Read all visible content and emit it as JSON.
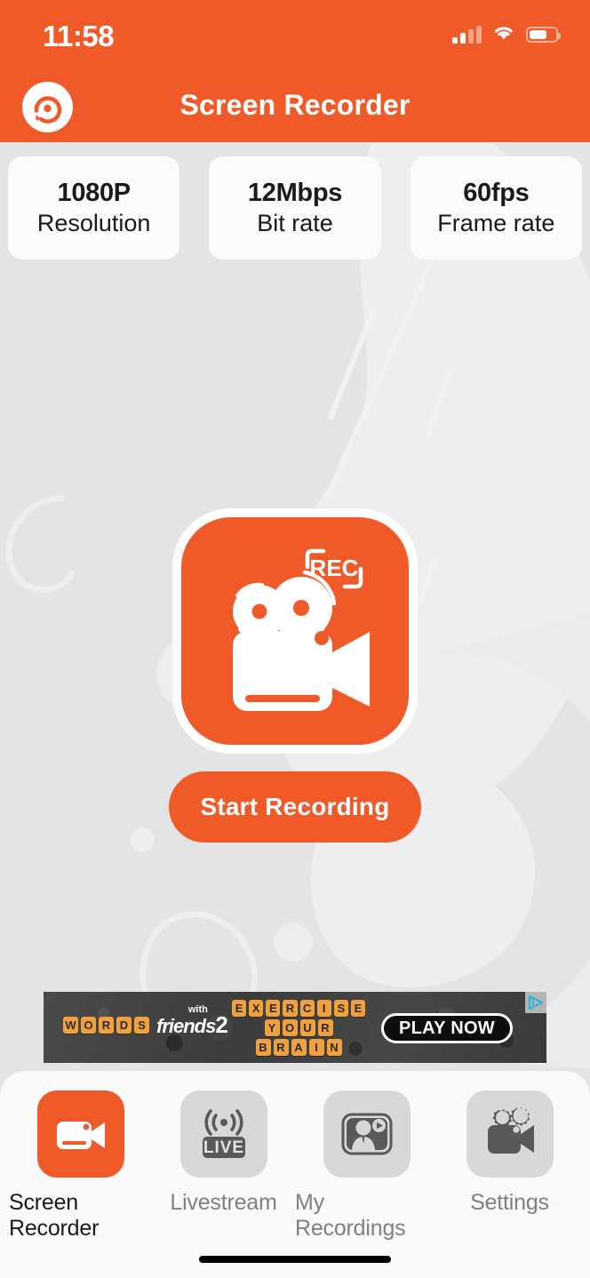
{
  "status_bar": {
    "time": "11:58",
    "signal_icon": "cellular-signal-icon",
    "wifi_icon": "wifi-icon",
    "battery_icon": "battery-icon",
    "battery_level": "60"
  },
  "header": {
    "title": "Screen Recorder",
    "logo_icon": "app-logo-record-icon",
    "background_color": "#ef5a28"
  },
  "stats": [
    {
      "value": "1080P",
      "label": "Resolution",
      "name": "resolution"
    },
    {
      "value": "12Mbps",
      "label": "Bit rate",
      "name": "bit-rate"
    },
    {
      "value": "60fps",
      "label": "Frame rate",
      "name": "frame-rate"
    }
  ],
  "main": {
    "record_tile_icon": "movie-camera-rec-icon",
    "rec_badge_text": "REC",
    "start_button_label": "Start Recording",
    "accent_color": "#ef5a28",
    "background_color": "#e3e4e5"
  },
  "ad": {
    "brand_tiles": [
      "W",
      "O",
      "R",
      "D",
      "S"
    ],
    "brand_with": "with",
    "brand_friends": "friends",
    "brand_number": "2",
    "slogan_rows": [
      [
        "E",
        "X",
        "E",
        "R",
        "C",
        "I",
        "S",
        "E"
      ],
      [
        "Y",
        "O",
        "U",
        "R"
      ],
      [
        "B",
        "R",
        "A",
        "I",
        "N"
      ]
    ],
    "cta_label": "PLAY NOW",
    "adchoices_icon": "adchoices-icon"
  },
  "tabs": [
    {
      "label": "Screen Recorder",
      "icon": "video-camera-icon",
      "active": true
    },
    {
      "label": "Livestream",
      "icon": "live-broadcast-icon",
      "active": false
    },
    {
      "label": "My Recordings",
      "icon": "person-video-frame-icon",
      "active": false
    },
    {
      "label": "Settings",
      "icon": "camera-gear-icon",
      "active": false
    }
  ],
  "home_indicator": "home-indicator"
}
